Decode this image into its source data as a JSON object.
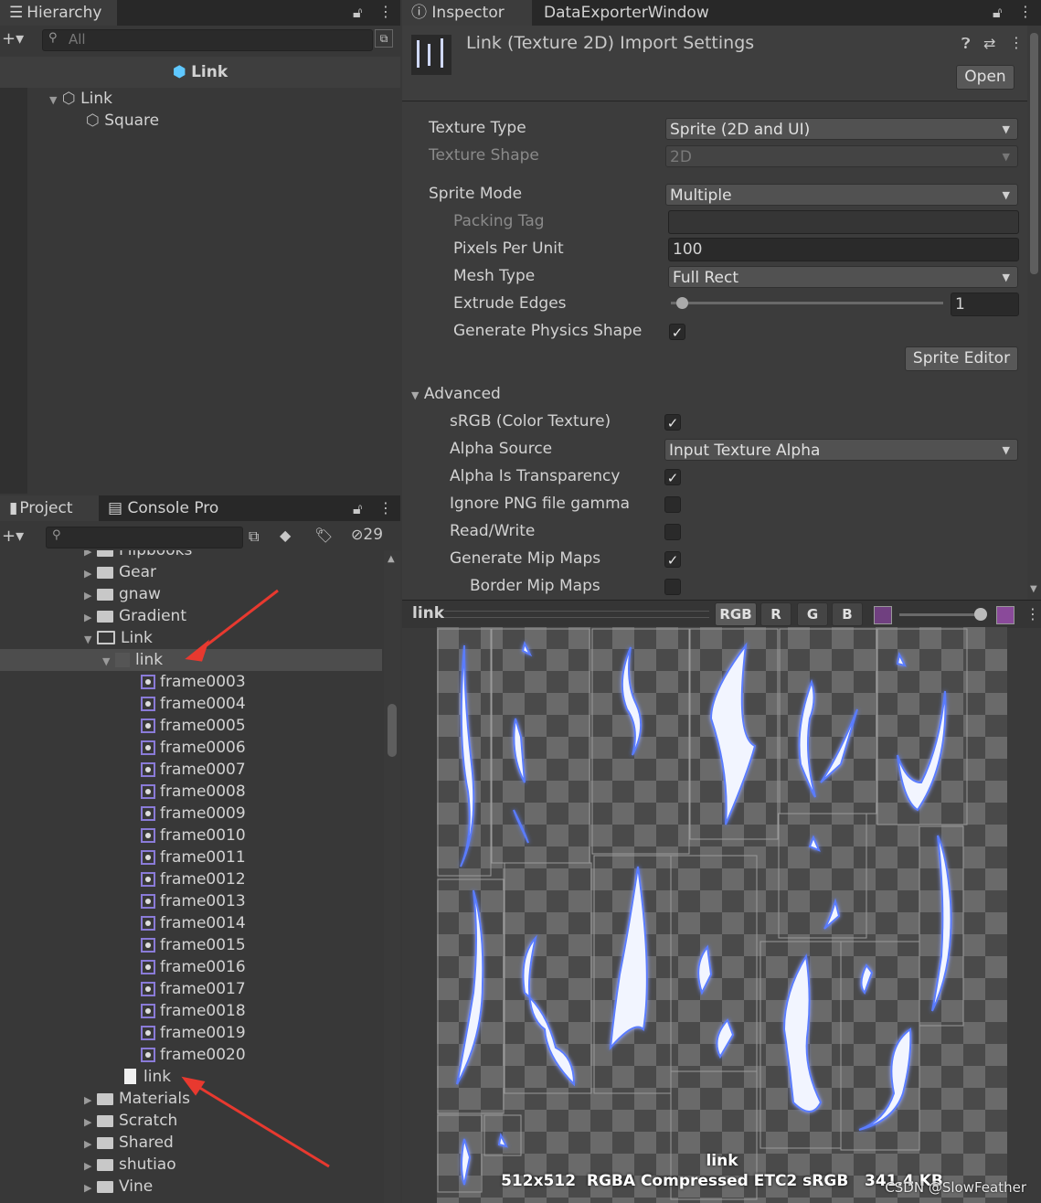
{
  "hierarchy": {
    "tab_label": "Hierarchy",
    "search_placeholder": "All",
    "scene_title": "Link",
    "items": [
      {
        "label": "Link",
        "depth": 0
      },
      {
        "label": "Square",
        "depth": 1
      }
    ]
  },
  "inspector": {
    "tabs": [
      "Inspector",
      "DataExporterWindow"
    ],
    "title": "Link (Texture 2D) Import Settings",
    "open_button": "Open",
    "fields": {
      "texture_type": {
        "label": "Texture Type",
        "value": "Sprite (2D and UI)"
      },
      "texture_shape": {
        "label": "Texture Shape",
        "value": "2D"
      },
      "sprite_mode": {
        "label": "Sprite Mode",
        "value": "Multiple"
      },
      "packing_tag": {
        "label": "Packing Tag",
        "value": ""
      },
      "pixels_per_unit": {
        "label": "Pixels Per Unit",
        "value": "100"
      },
      "mesh_type": {
        "label": "Mesh Type",
        "value": "Full Rect"
      },
      "extrude_edges": {
        "label": "Extrude Edges",
        "value": "1"
      },
      "generate_physics_shape": {
        "label": "Generate Physics Shape",
        "checked": true
      }
    },
    "sprite_editor_button": "Sprite Editor",
    "advanced": {
      "label": "Advanced",
      "srgb": {
        "label": "sRGB (Color Texture)",
        "checked": true
      },
      "alpha_source": {
        "label": "Alpha Source",
        "value": "Input Texture Alpha"
      },
      "alpha_is_transparency": {
        "label": "Alpha Is Transparency",
        "checked": true
      },
      "ignore_png_gamma": {
        "label": "Ignore PNG file gamma",
        "checked": false
      },
      "read_write": {
        "label": "Read/Write",
        "checked": false
      },
      "generate_mip_maps": {
        "label": "Generate Mip Maps",
        "checked": true
      },
      "border_mip_maps": {
        "label": "Border Mip Maps",
        "checked": false
      }
    }
  },
  "preview": {
    "title": "link",
    "channels": [
      "RGB",
      "R",
      "G",
      "B"
    ],
    "image_label": "link",
    "info": "512x512  RGBA Compressed ETC2 sRGB   341.4 KB",
    "watermark": "CSDN @SlowFeather"
  },
  "project": {
    "tabs": [
      "Project",
      "Console Pro"
    ],
    "hidden_count": "29",
    "tree": [
      {
        "label": "Flipbooks",
        "type": "folder",
        "expanded": false,
        "indent": 0
      },
      {
        "label": "Gear",
        "type": "folder",
        "expanded": false,
        "indent": 0
      },
      {
        "label": "gnaw",
        "type": "folder",
        "expanded": false,
        "indent": 0
      },
      {
        "label": "Gradient",
        "type": "folder",
        "expanded": false,
        "indent": 0
      },
      {
        "label": "Link",
        "type": "folder-open",
        "expanded": true,
        "indent": 0
      },
      {
        "label": "link",
        "type": "texture",
        "expanded": true,
        "indent": 1,
        "selected": true
      },
      {
        "label": "frame0003",
        "type": "sprite",
        "indent": 2
      },
      {
        "label": "frame0004",
        "type": "sprite",
        "indent": 2
      },
      {
        "label": "frame0005",
        "type": "sprite",
        "indent": 2
      },
      {
        "label": "frame0006",
        "type": "sprite",
        "indent": 2
      },
      {
        "label": "frame0007",
        "type": "sprite",
        "indent": 2
      },
      {
        "label": "frame0008",
        "type": "sprite",
        "indent": 2
      },
      {
        "label": "frame0009",
        "type": "sprite",
        "indent": 2
      },
      {
        "label": "frame0010",
        "type": "sprite",
        "indent": 2
      },
      {
        "label": "frame0011",
        "type": "sprite",
        "indent": 2
      },
      {
        "label": "frame0012",
        "type": "sprite",
        "indent": 2
      },
      {
        "label": "frame0013",
        "type": "sprite",
        "indent": 2
      },
      {
        "label": "frame0014",
        "type": "sprite",
        "indent": 2
      },
      {
        "label": "frame0015",
        "type": "sprite",
        "indent": 2
      },
      {
        "label": "frame0016",
        "type": "sprite",
        "indent": 2
      },
      {
        "label": "frame0017",
        "type": "sprite",
        "indent": 2
      },
      {
        "label": "frame0018",
        "type": "sprite",
        "indent": 2
      },
      {
        "label": "frame0019",
        "type": "sprite",
        "indent": 2
      },
      {
        "label": "frame0020",
        "type": "sprite",
        "indent": 2
      },
      {
        "label": "link",
        "type": "file",
        "indent": 1
      },
      {
        "label": "Materials",
        "type": "folder",
        "expanded": false,
        "indent": 0
      },
      {
        "label": "Scratch",
        "type": "folder",
        "expanded": false,
        "indent": 0
      },
      {
        "label": "Shared",
        "type": "folder",
        "expanded": false,
        "indent": 0
      },
      {
        "label": "shutiao",
        "type": "folder",
        "expanded": false,
        "indent": 0
      },
      {
        "label": "Vine",
        "type": "folder",
        "expanded": false,
        "indent": 0
      }
    ]
  },
  "colors": {
    "panel_bg": "#383838",
    "selected_row": "#4d4d4d",
    "annotation_arrow": "#e8392f",
    "sprite_glow": "#4a6bff"
  }
}
